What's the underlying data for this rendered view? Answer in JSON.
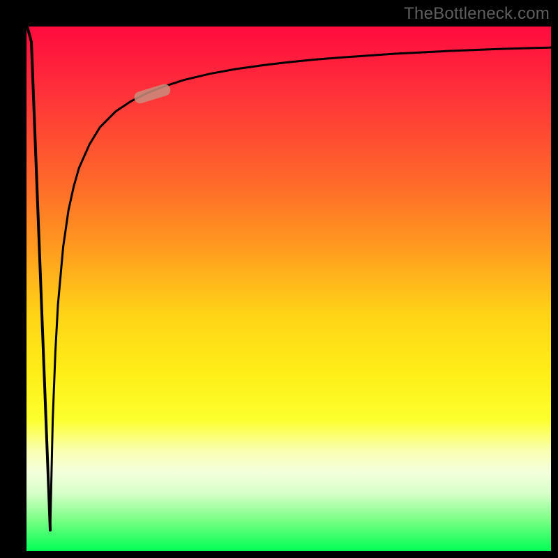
{
  "watermark": "TheBottleneck.com",
  "colors": {
    "frame": "#000000",
    "curve": "#000000",
    "marker": "#c98d7d",
    "gradient_top": "#ff0b3f",
    "gradient_bottom": "#00ff55"
  },
  "chart_data": {
    "type": "line",
    "title": "",
    "xlabel": "",
    "ylabel": "",
    "xlim": [
      0,
      100
    ],
    "ylim": [
      0,
      100
    ],
    "grid": false,
    "legend": null,
    "annotations": [],
    "series": [
      {
        "name": "left-spike",
        "x": [
          0.2,
          0.9,
          4.5
        ],
        "y": [
          100,
          97,
          4
        ]
      },
      {
        "name": "main-curve",
        "x": [
          4.5,
          5,
          5.5,
          6,
          7,
          8,
          9,
          10,
          12,
          14,
          17,
          20,
          23,
          26,
          30,
          35,
          40,
          45,
          50,
          55,
          60,
          70,
          80,
          90,
          100
        ],
        "y": [
          4,
          25,
          38,
          47,
          58,
          65,
          69.5,
          73,
          77.5,
          80.8,
          83.8,
          85.8,
          87.3,
          88.5,
          89.8,
          91.0,
          91.9,
          92.6,
          93.2,
          93.7,
          94.1,
          94.8,
          95.3,
          95.7,
          96.0
        ]
      }
    ],
    "marker": {
      "note": "highlighted pill-shaped region on the ascending part of the curve",
      "x_range": [
        21,
        27.5
      ],
      "y_range": [
        86,
        89
      ]
    },
    "background": {
      "type": "vertical_gradient",
      "top_color": "red",
      "bottom_color": "green",
      "description": "spectrum from red at top through orange, yellow, pale, to green at bottom"
    }
  }
}
